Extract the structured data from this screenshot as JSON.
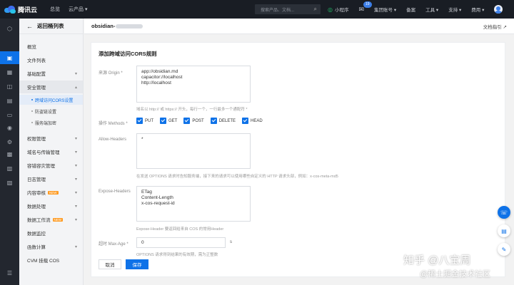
{
  "topbar": {
    "brand": "腾讯云",
    "nav": [
      "总览",
      "云产品 ▾"
    ],
    "search_placeholder": "搜索产品、文档...",
    "search_icon": "search-icon",
    "right": {
      "miniapp": "小程序",
      "mail_badge": "19",
      "account": "集团账号 ▾",
      "record": "备案",
      "tools": "工具 ▾",
      "support": "支持 ▾",
      "billing": "费用 ▾"
    }
  },
  "sidebar": {
    "back_label": "返回桶列表",
    "items": [
      {
        "label": "概览"
      },
      {
        "label": "文件列表"
      },
      {
        "label": "基础配置",
        "chevron": "▾"
      },
      {
        "label": "安全管理",
        "chevron": "▴"
      },
      {
        "label": "权限管理",
        "chevron": "▾"
      },
      {
        "label": "域名与传输管理",
        "chevron": "▾"
      },
      {
        "label": "容错容灾管理",
        "chevron": "▾"
      },
      {
        "label": "日志管理",
        "chevron": "▾"
      },
      {
        "label": "内容审核",
        "tag": "NEW",
        "chevron": "▾"
      },
      {
        "label": "数据处理",
        "chevron": "▾"
      },
      {
        "label": "数据工作流",
        "tag": "NEW",
        "chevron": "▾"
      },
      {
        "label": "数据监控"
      },
      {
        "label": "函数计算",
        "chevron": "▾"
      },
      {
        "label": "CVM 挂载 COS"
      }
    ],
    "sub_items": [
      {
        "label": "跨域访问CORS设置",
        "active": true
      },
      {
        "label": "防盗链设置"
      },
      {
        "label": "服务端加密"
      }
    ]
  },
  "header": {
    "bucket_name": "obsidian-",
    "doc_link": "文档指引 ↗"
  },
  "form": {
    "title": "添加跨域访问CORS规则",
    "origin": {
      "label": "来源 Origin *",
      "lines": [
        "app://obsidian.md",
        "capacitor://localhost",
        "http://localhost"
      ],
      "hint": "域名以 http:// 或 https:// 开头，每行一个，一行最多一个通配符 *"
    },
    "methods": {
      "label": "操作 Methods *",
      "options": [
        "PUT",
        "GET",
        "POST",
        "DELETE",
        "HEAD"
      ]
    },
    "allow_headers": {
      "label": "Allow-Headers",
      "lines": [
        "*"
      ],
      "hint": "在发送 OPTIONS 请求时告知服务端，接下来的请求可以使用哪些自定义的 HTTP 请求头部，例如：x-cos-meta-md5"
    },
    "expose_headers": {
      "label": "Expose-Headers",
      "lines": [
        "ETag",
        "Content-Length",
        "x-cos-request-id"
      ],
      "hint": "Expose-Header 要返回给来自 COS 的常用Header"
    },
    "max_age": {
      "label": "超时 Max-Age *",
      "value": "0",
      "unit": "s",
      "hint": "OPTIONS 请求得到结果的有效期，需为正整数"
    },
    "cancel_label": "取消",
    "save_label": "保存"
  },
  "watermark": {
    "line1": "知乎 @八宝周",
    "line2": "@稀土掘金技术社区"
  },
  "colors": {
    "primary": "#0e72e8",
    "topbar_bg": "#191d24",
    "rail_bg": "#23272f"
  }
}
